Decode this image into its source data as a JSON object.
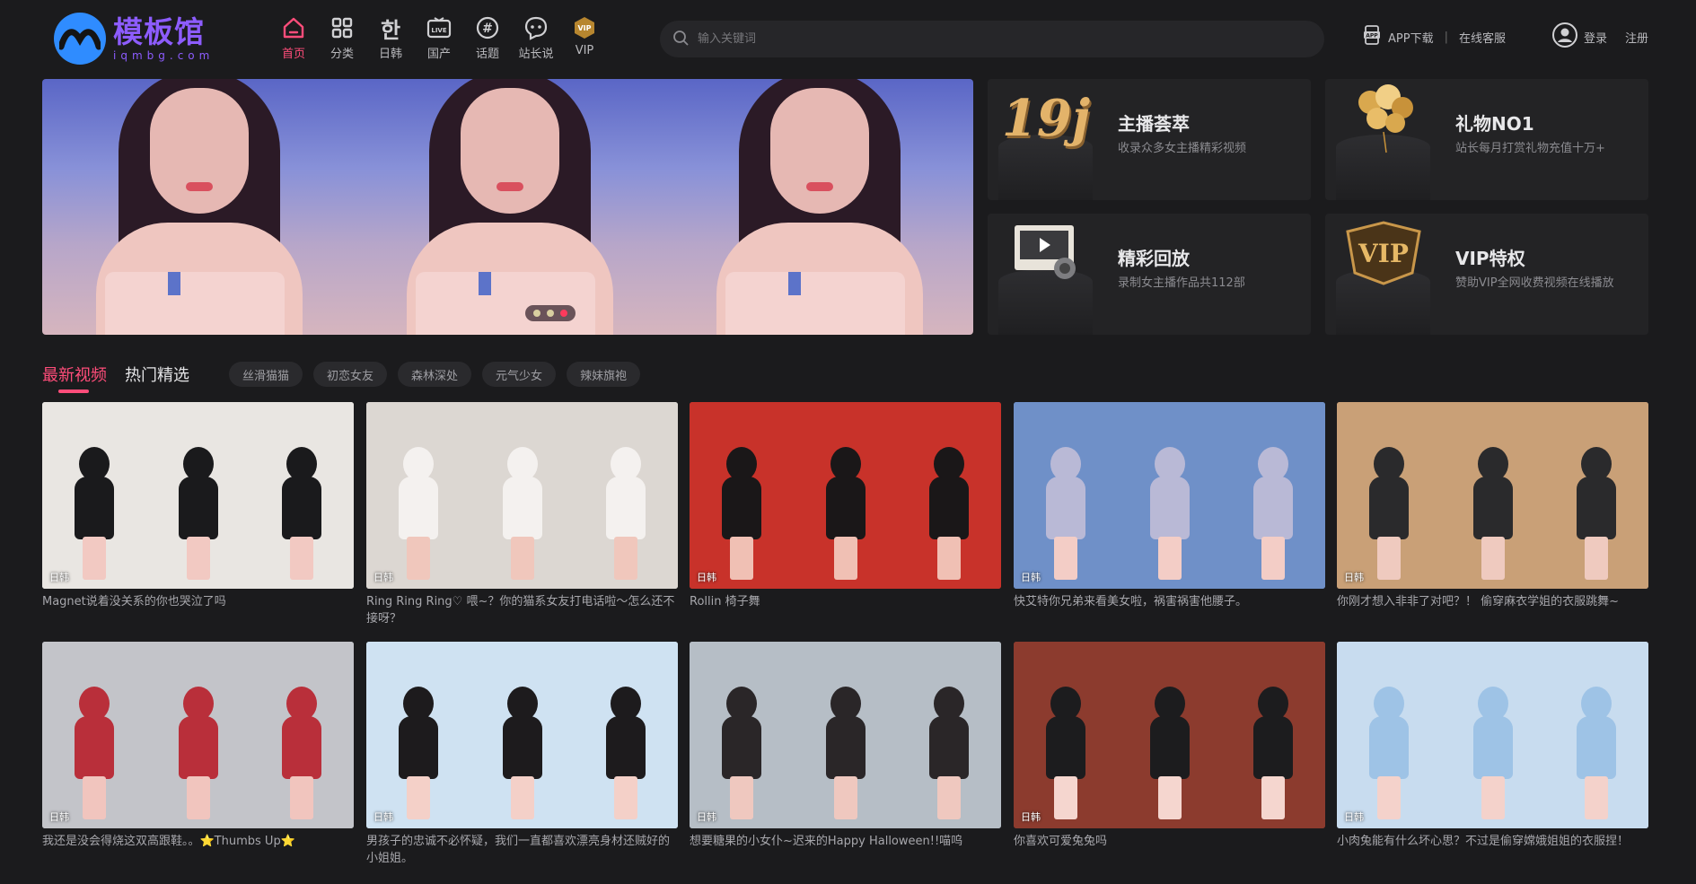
{
  "brand": {
    "title": "模板馆",
    "subtitle": "iqmbg.com",
    "accent": "#8d5cff",
    "mark_color": "#2f8cff"
  },
  "nav": [
    {
      "label": "首页",
      "icon": "home-icon",
      "active": true
    },
    {
      "label": "分类",
      "icon": "grid-icon",
      "active": false
    },
    {
      "label": "日韩",
      "icon": "hangul-icon",
      "active": false
    },
    {
      "label": "国产",
      "icon": "live-tv-icon",
      "active": false
    },
    {
      "label": "话题",
      "icon": "hashtag-icon",
      "active": false
    },
    {
      "label": "站长说",
      "icon": "chat-bubble-icon",
      "active": false
    },
    {
      "label": "VIP",
      "icon": "vip-icon",
      "active": false
    }
  ],
  "search": {
    "placeholder": "输入关键词"
  },
  "header_right": {
    "app": "APP下载",
    "service": "在线客服",
    "login": "登录",
    "register": "注册"
  },
  "banner": {
    "slides": 3,
    "active_dot": 3
  },
  "features": [
    {
      "title": "主播荟萃",
      "subtitle": "收录众多女主播精彩视频",
      "icon": "19j-logo-icon"
    },
    {
      "title": "礼物NO1",
      "subtitle": "站长每月打赏礼物充值十万+",
      "icon": "balloons-icon"
    },
    {
      "title": "精彩回放",
      "subtitle": "录制女主播作品共112部",
      "icon": "video-player-icon"
    },
    {
      "title": "VIP特权",
      "subtitle": "赞助VIP全网收费视频在线播放",
      "icon": "vip-badge-icon"
    }
  ],
  "tabs": {
    "latest": "最新视频",
    "hot": "热门精选"
  },
  "chips": [
    "丝滑猫猫",
    "初恋女友",
    "森林深处",
    "元气少女",
    "辣妹旗袍"
  ],
  "accent_color": "#ff4d7a",
  "videos": [
    {
      "region": "日韩",
      "title": "Magnet说着没关系的你也哭泣了吗"
    },
    {
      "region": "日韩",
      "title": "Ring Ring Ring♡ 喂~？你的猫系女友打电话啦～怎么还不接呀？"
    },
    {
      "region": "日韩",
      "title": "Rollin 椅子舞"
    },
    {
      "region": "日韩",
      "title": "快艾特你兄弟来看美女啦，祸害祸害他腰子。"
    },
    {
      "region": "日韩",
      "title": "你刚才想入非非了对吧？！ 偷穿麻衣学姐的衣服跳舞~"
    },
    {
      "region": "日韩",
      "title": "我还是没会得烧这双高跟鞋。。⭐Thumbs Up⭐"
    },
    {
      "region": "日韩",
      "title": "男孩子的忠诚不必怀疑，我们一直都喜欢漂亮身材还贼好的小姐姐。"
    },
    {
      "region": "日韩",
      "title": "想要糖果的小女仆~迟来的Happy Halloween!!喵呜"
    },
    {
      "region": "日韩",
      "title": "你喜欢可爱兔兔吗"
    },
    {
      "region": "日韩",
      "title": "小肉兔能有什么坏心思？不过是偷穿嫦娥姐姐的衣服捏！"
    }
  ]
}
